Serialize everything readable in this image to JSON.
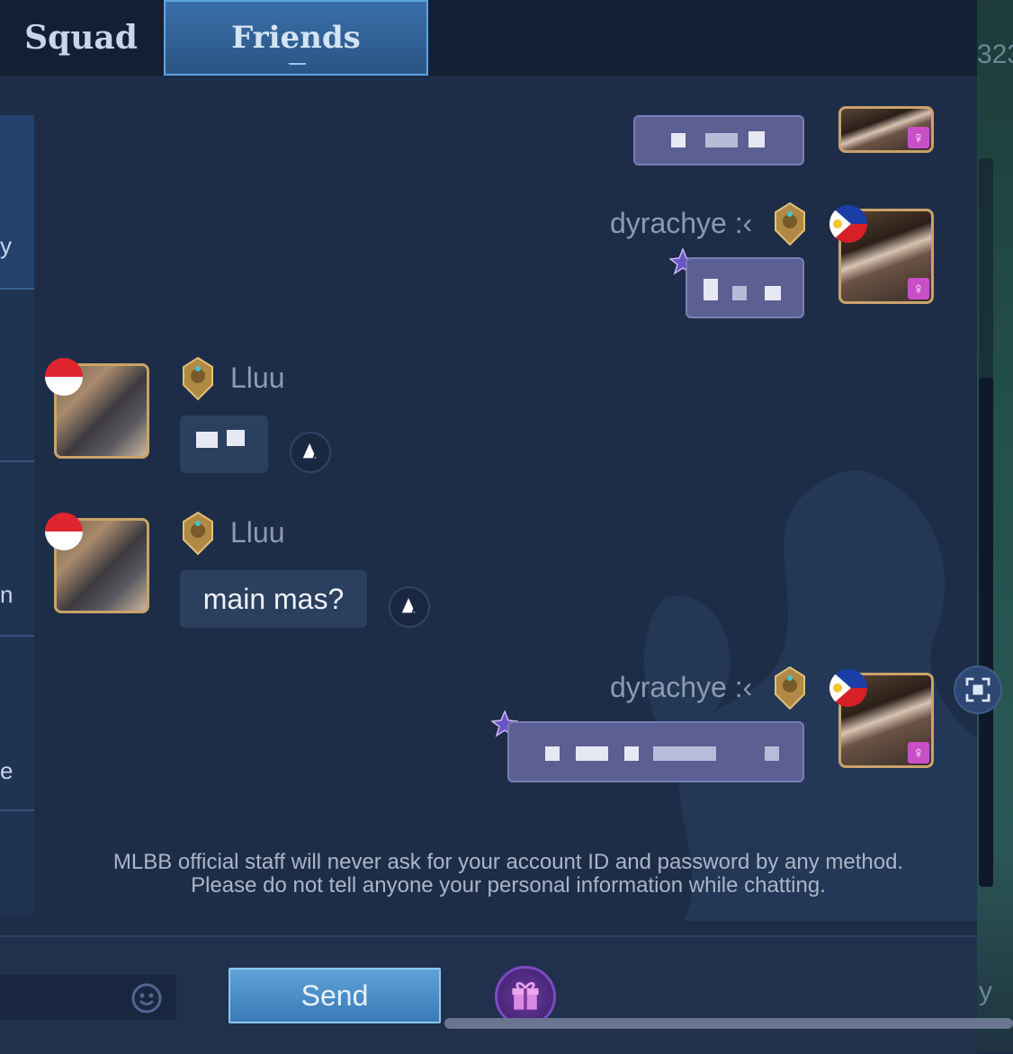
{
  "tabs": {
    "squad": "Squad",
    "friends": "Friends"
  },
  "edge": {
    "number_fragment": "323",
    "letter_fragment": "y"
  },
  "sidebar": {
    "fragments": [
      "y",
      "n",
      "e"
    ]
  },
  "messages": [
    {
      "sender": "dyrachye :‹",
      "side": "right",
      "text": ""
    },
    {
      "sender": "Lluu",
      "side": "left",
      "text": ""
    },
    {
      "sender": "Lluu",
      "side": "left",
      "text": "main mas?"
    },
    {
      "sender": "dyrachye :‹",
      "side": "right",
      "text": ""
    }
  ],
  "gender_symbol": "♀",
  "notice": "MLBB official staff will never ask for your account ID and password by any method. Please do not tell anyone your personal information while chatting.",
  "input": {
    "value": ""
  },
  "send_label": "Send",
  "icons": [
    "emoji-icon",
    "gift-icon",
    "translate-icon",
    "fullscreen-icon",
    "star-icon",
    "rank-badge-icon",
    "gender-female-icon",
    "flag-icon"
  ],
  "colors": {
    "accent": "#3b7bb8",
    "bubble_me": "#5c5f92",
    "bubble_other": "#2b3f5f",
    "background": "#1e2d47"
  }
}
